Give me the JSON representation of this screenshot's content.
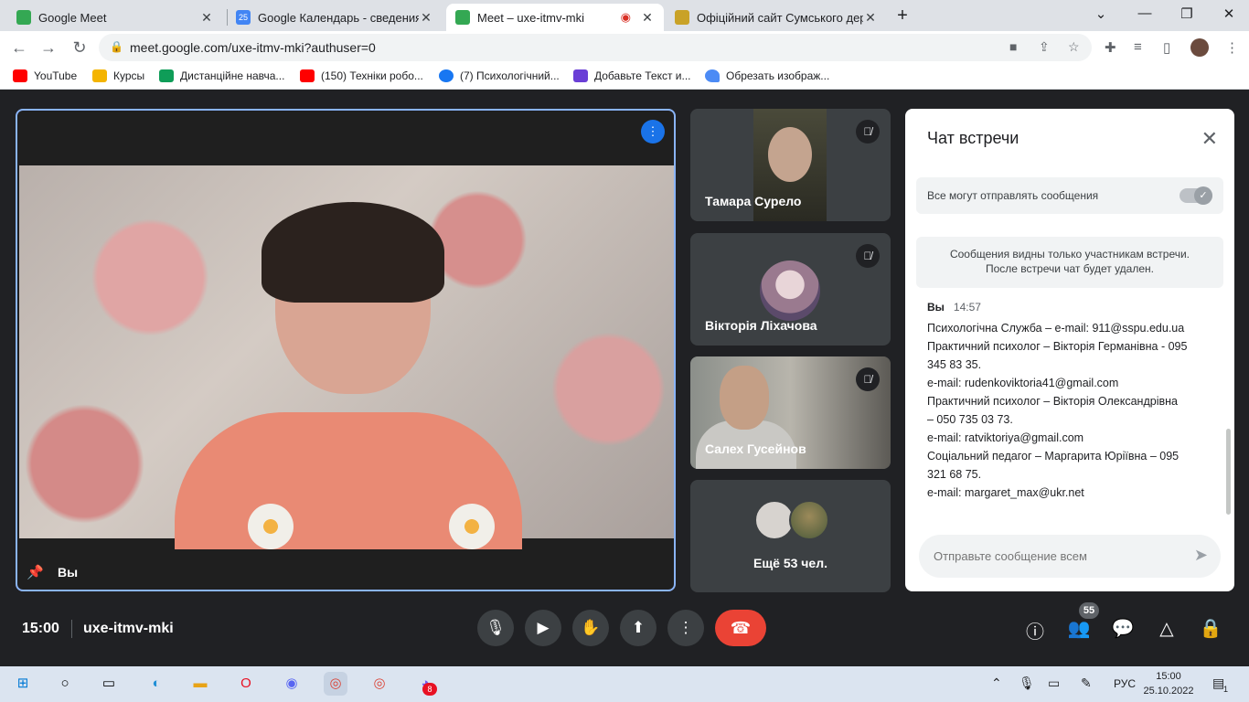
{
  "browser": {
    "tabs": [
      {
        "title": "Google Meet",
        "favicon_color": "#34a853"
      },
      {
        "title": "Google Календарь - сведения о",
        "favicon_color": "#4285f4"
      },
      {
        "title": "Meet – uxe-itmv-mki",
        "favicon_color": "#34a853",
        "active": true,
        "recording": true
      },
      {
        "title": "Офіційний сайт Сумського держ",
        "favicon_color": "#c9a227"
      }
    ],
    "new_tab": "+",
    "url": "meet.google.com/uxe-itmv-mki?authuser=0",
    "bookmarks": [
      {
        "label": "YouTube",
        "color": "#ff0000"
      },
      {
        "label": "Курсы",
        "color": "#f4b400"
      },
      {
        "label": "Дистанційне навча...",
        "color": "#0f9d58"
      },
      {
        "label": "(150) Техніки робо...",
        "color": "#ff0000"
      },
      {
        "label": "(7) Психологічний...",
        "color": "#1877f2"
      },
      {
        "label": "Добавьте Текст и...",
        "color": "#6a3fd6"
      },
      {
        "label": "Обрезать изображ...",
        "color": "#4c8bf5"
      }
    ]
  },
  "meet": {
    "main_tile": {
      "name": "Вы"
    },
    "participants": [
      {
        "name": "Тамара Сурело"
      },
      {
        "name": "Вікторія Ліхачова"
      },
      {
        "name": "Салех Гусейнов"
      }
    ],
    "more_tile": {
      "label": "Ещё 53 чел."
    },
    "chat": {
      "title": "Чат встречи",
      "allow_label": "Все могут отправлять сообщения",
      "notice_line1": "Сообщения видны только участникам встречи.",
      "notice_line2": "После встречи чат будет удален.",
      "message": {
        "author": "Вы",
        "time": "14:57",
        "lines": [
          "Психологічна Служба – e-mail: 911@sspu.edu.ua",
          "Практичний психолог – Вікторія Германівна - 095",
          "345 83 35.",
          "e-mail: rudenkoviktoria41@gmail.com",
          "Практичний психолог – Вікторія Олександрівна",
          "– 050 735 03 73.",
          "e-mail: ratviktoriya@gmail.com",
          "Соціальний педагог – Маргарита Юріївна – 095",
          "321 68 75.",
          "e-mail: margaret_max@ukr.net"
        ]
      },
      "input_placeholder": "Отправьте сообщение всем"
    },
    "bottom": {
      "time": "15:00",
      "meeting_code": "uxe-itmv-mki",
      "participants_count": "55"
    },
    "colors": {
      "accent": "#8ab4f8",
      "end_call": "#ea4335",
      "chat_icon": "#8ab4f8"
    }
  },
  "taskbar": {
    "language": "РУС",
    "time": "15:00",
    "date": "25.10.2022",
    "viber_badge": "8",
    "notifications": "1"
  }
}
